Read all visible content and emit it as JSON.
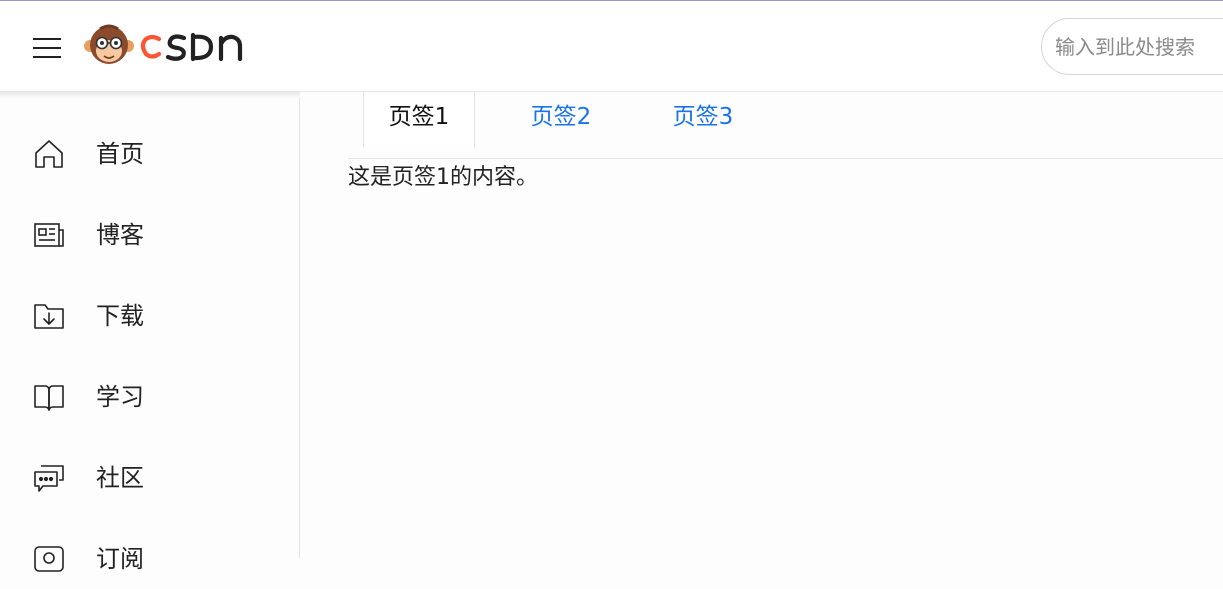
{
  "header": {
    "logo_text": "csdn",
    "search_placeholder": "输入到此处搜索"
  },
  "sidebar": {
    "items": [
      {
        "label": "首页",
        "icon": "home-icon"
      },
      {
        "label": "博客",
        "icon": "blog-icon"
      },
      {
        "label": "下载",
        "icon": "download-icon"
      },
      {
        "label": "学习",
        "icon": "book-icon"
      },
      {
        "label": "社区",
        "icon": "community-icon"
      },
      {
        "label": "订阅",
        "icon": "subscribe-icon"
      }
    ]
  },
  "tabs": [
    {
      "label": "页签1",
      "active": true
    },
    {
      "label": "页签2",
      "active": false
    },
    {
      "label": "页签3",
      "active": false
    }
  ],
  "content": {
    "text": "这是页签1的内容。"
  },
  "colors": {
    "accent_link": "#1a73e8",
    "logo_orange": "#fc5531"
  }
}
